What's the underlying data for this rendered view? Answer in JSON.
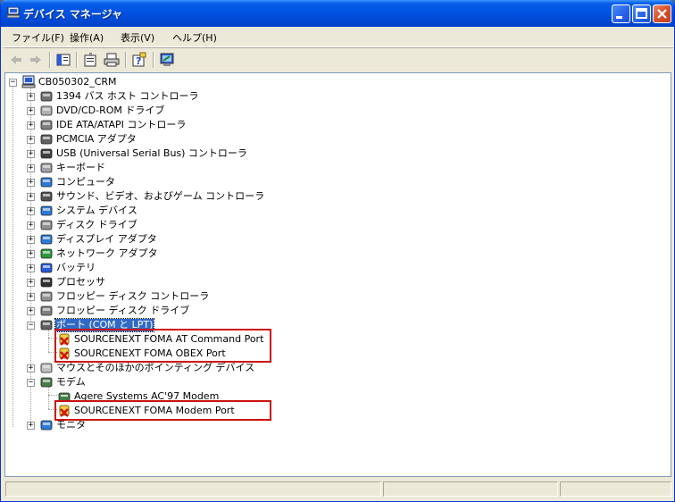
{
  "window": {
    "title": "デバイス マネージャ",
    "title_icon": "device-manager-icon",
    "controls": [
      "minimize",
      "maximize",
      "close"
    ]
  },
  "menu": {
    "items": [
      {
        "label": "ファイル(F)"
      },
      {
        "label": "操作(A)"
      },
      {
        "label": "表示(V)"
      },
      {
        "label": "ヘルプ(H)"
      }
    ]
  },
  "toolbar": {
    "buttons": [
      "back-icon",
      "forward-icon",
      "show-hide-console-tree-icon",
      "properties-icon",
      "print-icon",
      "help-icon",
      "scan-hardware-icon"
    ]
  },
  "tree": {
    "root": {
      "label": "CB050302_CRM",
      "icon": "computer-icon"
    },
    "categories": [
      {
        "label": "1394 バス ホスト コントローラ",
        "icon": "bus-controller-icon"
      },
      {
        "label": "DVD/CD-ROM ドライブ",
        "icon": "cdrom-icon"
      },
      {
        "label": "IDE ATA/ATAPI コントローラ",
        "icon": "ide-controller-icon"
      },
      {
        "label": "PCMCIA アダプタ",
        "icon": "pcmcia-icon"
      },
      {
        "label": "USB (Universal Serial Bus) コントローラ",
        "icon": "usb-icon"
      },
      {
        "label": "キーボード",
        "icon": "keyboard-icon"
      },
      {
        "label": "コンピュータ",
        "icon": "computer-category-icon"
      },
      {
        "label": "サウンド、ビデオ、およびゲーム コントローラ",
        "icon": "sound-icon"
      },
      {
        "label": "システム デバイス",
        "icon": "system-device-icon"
      },
      {
        "label": "ディスク ドライブ",
        "icon": "disk-drive-icon"
      },
      {
        "label": "ディスプレイ アダプタ",
        "icon": "display-adapter-icon"
      },
      {
        "label": "ネットワーク アダプタ",
        "icon": "network-adapter-icon"
      },
      {
        "label": "バッテリ",
        "icon": "battery-icon"
      },
      {
        "label": "プロセッサ",
        "icon": "processor-icon"
      },
      {
        "label": "フロッピー ディスク コントローラ",
        "icon": "floppy-controller-icon"
      },
      {
        "label": "フロッピー ディスク ドライブ",
        "icon": "floppy-drive-icon"
      },
      {
        "label": "ポート (COM と LPT)",
        "icon": "port-icon",
        "expanded": true,
        "selected": true,
        "children": [
          {
            "label": "SOURCENEXT FOMA AT Command Port",
            "icon": "port-error-icon"
          },
          {
            "label": "SOURCENEXT FOMA OBEX Port",
            "icon": "port-error-icon"
          }
        ]
      },
      {
        "label": "マウスとそのほかのポインティング デバイス",
        "icon": "mouse-icon"
      },
      {
        "label": "モデム",
        "icon": "modem-icon",
        "expanded": true,
        "children": [
          {
            "label": "Agere Systems AC'97 Modem",
            "icon": "modem-device-icon"
          },
          {
            "label": "SOURCENEXT FOMA Modem Port",
            "icon": "modem-error-icon"
          }
        ]
      },
      {
        "label": "モニタ",
        "icon": "monitor-icon"
      }
    ]
  },
  "colors": {
    "titlebar": "#0054e3",
    "selection": "#316ac5",
    "highlight_box": "#cc1111"
  }
}
